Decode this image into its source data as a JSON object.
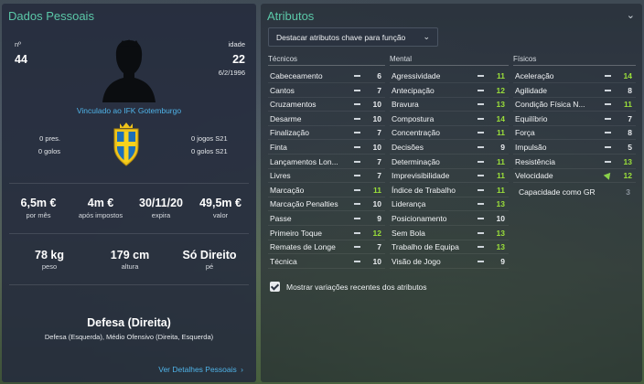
{
  "personal": {
    "title": "Dados Pessoais",
    "number_label": "nº",
    "number": "44",
    "age_label": "idade",
    "age": "22",
    "birthdate": "6/2/1996",
    "club_link": "Vinculado ao IFK Gotemburgo",
    "stats_left": [
      "0 pres.",
      "0 golos"
    ],
    "stats_right": [
      "0 jogos S21",
      "0 golos S21"
    ],
    "contract": [
      {
        "value": "6,5m €",
        "label": "por mês"
      },
      {
        "value": "4m €",
        "label": "após impostos"
      },
      {
        "value": "30/11/20",
        "label": "expira"
      },
      {
        "value": "49,5m €",
        "label": "valor"
      }
    ],
    "physical": [
      {
        "value": "78 kg",
        "label": "peso"
      },
      {
        "value": "179 cm",
        "label": "altura"
      },
      {
        "value": "Só Direito",
        "label": "pé"
      }
    ],
    "position_main": "Defesa (Direita)",
    "position_other": "Defesa (Esquerda), Médio Ofensivo (Direita, Esquerda)",
    "details_link": "Ver Detalhes Pessoais"
  },
  "attributes": {
    "title": "Atributos",
    "dropdown": "Destacar atributos chave para função",
    "col_tecnicos": "Técnicos",
    "col_mental": "Mental",
    "col_fisicos": "Físicos",
    "tecnicos": [
      {
        "name": "Cabeceamento",
        "value": "6",
        "color": "white"
      },
      {
        "name": "Cantos",
        "value": "7",
        "color": "white"
      },
      {
        "name": "Cruzamentos",
        "value": "10",
        "color": "white"
      },
      {
        "name": "Desarme",
        "value": "10",
        "color": "white"
      },
      {
        "name": "Finalização",
        "value": "7",
        "color": "white"
      },
      {
        "name": "Finta",
        "value": "10",
        "color": "white"
      },
      {
        "name": "Lançamentos Lon...",
        "value": "7",
        "color": "white"
      },
      {
        "name": "Livres",
        "value": "7",
        "color": "white"
      },
      {
        "name": "Marcação",
        "value": "11",
        "color": "green"
      },
      {
        "name": "Marcação Penalties",
        "value": "10",
        "color": "white"
      },
      {
        "name": "Passe",
        "value": "9",
        "color": "white"
      },
      {
        "name": "Primeiro Toque",
        "value": "12",
        "color": "green"
      },
      {
        "name": "Remates de Longe",
        "value": "7",
        "color": "white"
      },
      {
        "name": "Técnica",
        "value": "10",
        "color": "white"
      }
    ],
    "mental": [
      {
        "name": "Agressividade",
        "value": "11",
        "color": "green"
      },
      {
        "name": "Antecipação",
        "value": "12",
        "color": "green"
      },
      {
        "name": "Bravura",
        "value": "13",
        "color": "green"
      },
      {
        "name": "Compostura",
        "value": "14",
        "color": "green"
      },
      {
        "name": "Concentração",
        "value": "11",
        "color": "green"
      },
      {
        "name": "Decisões",
        "value": "9",
        "color": "white"
      },
      {
        "name": "Determinação",
        "value": "11",
        "color": "green"
      },
      {
        "name": "Imprevisibilidade",
        "value": "11",
        "color": "green"
      },
      {
        "name": "Índice de Trabalho",
        "value": "11",
        "color": "green"
      },
      {
        "name": "Liderança",
        "value": "13",
        "color": "green"
      },
      {
        "name": "Posicionamento",
        "value": "10",
        "color": "white"
      },
      {
        "name": "Sem Bola",
        "value": "13",
        "color": "green"
      },
      {
        "name": "Trabalho de Equipa",
        "value": "13",
        "color": "green"
      },
      {
        "name": "Visão de Jogo",
        "value": "9",
        "color": "white"
      }
    ],
    "fisicos": [
      {
        "name": "Aceleração",
        "value": "14",
        "color": "green"
      },
      {
        "name": "Agilidade",
        "value": "8",
        "color": "white"
      },
      {
        "name": "Condição Física N...",
        "value": "11",
        "color": "green"
      },
      {
        "name": "Equilíbrio",
        "value": "7",
        "color": "white"
      },
      {
        "name": "Força",
        "value": "8",
        "color": "white"
      },
      {
        "name": "Impulsão",
        "value": "5",
        "color": "white"
      },
      {
        "name": "Resistência",
        "value": "13",
        "color": "green"
      },
      {
        "name": "Velocidade",
        "value": "12",
        "color": "green",
        "trend": "up"
      }
    ],
    "gk_label": "Capacidade como GR",
    "gk_value": "3",
    "checkbox_label": "Mostrar variações recentes dos atributos"
  }
}
